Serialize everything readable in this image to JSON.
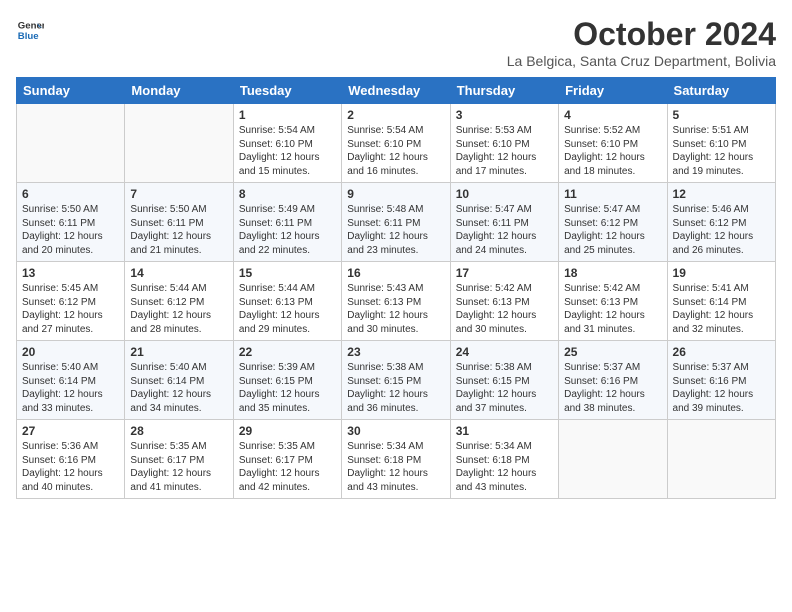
{
  "header": {
    "logo_line1": "General",
    "logo_line2": "Blue",
    "month": "October 2024",
    "location": "La Belgica, Santa Cruz Department, Bolivia"
  },
  "days_of_week": [
    "Sunday",
    "Monday",
    "Tuesday",
    "Wednesday",
    "Thursday",
    "Friday",
    "Saturday"
  ],
  "weeks": [
    [
      {
        "day": "",
        "info": ""
      },
      {
        "day": "",
        "info": ""
      },
      {
        "day": "1",
        "info": "Sunrise: 5:54 AM\nSunset: 6:10 PM\nDaylight: 12 hours and 15 minutes."
      },
      {
        "day": "2",
        "info": "Sunrise: 5:54 AM\nSunset: 6:10 PM\nDaylight: 12 hours and 16 minutes."
      },
      {
        "day": "3",
        "info": "Sunrise: 5:53 AM\nSunset: 6:10 PM\nDaylight: 12 hours and 17 minutes."
      },
      {
        "day": "4",
        "info": "Sunrise: 5:52 AM\nSunset: 6:10 PM\nDaylight: 12 hours and 18 minutes."
      },
      {
        "day": "5",
        "info": "Sunrise: 5:51 AM\nSunset: 6:10 PM\nDaylight: 12 hours and 19 minutes."
      }
    ],
    [
      {
        "day": "6",
        "info": "Sunrise: 5:50 AM\nSunset: 6:11 PM\nDaylight: 12 hours and 20 minutes."
      },
      {
        "day": "7",
        "info": "Sunrise: 5:50 AM\nSunset: 6:11 PM\nDaylight: 12 hours and 21 minutes."
      },
      {
        "day": "8",
        "info": "Sunrise: 5:49 AM\nSunset: 6:11 PM\nDaylight: 12 hours and 22 minutes."
      },
      {
        "day": "9",
        "info": "Sunrise: 5:48 AM\nSunset: 6:11 PM\nDaylight: 12 hours and 23 minutes."
      },
      {
        "day": "10",
        "info": "Sunrise: 5:47 AM\nSunset: 6:11 PM\nDaylight: 12 hours and 24 minutes."
      },
      {
        "day": "11",
        "info": "Sunrise: 5:47 AM\nSunset: 6:12 PM\nDaylight: 12 hours and 25 minutes."
      },
      {
        "day": "12",
        "info": "Sunrise: 5:46 AM\nSunset: 6:12 PM\nDaylight: 12 hours and 26 minutes."
      }
    ],
    [
      {
        "day": "13",
        "info": "Sunrise: 5:45 AM\nSunset: 6:12 PM\nDaylight: 12 hours and 27 minutes."
      },
      {
        "day": "14",
        "info": "Sunrise: 5:44 AM\nSunset: 6:12 PM\nDaylight: 12 hours and 28 minutes."
      },
      {
        "day": "15",
        "info": "Sunrise: 5:44 AM\nSunset: 6:13 PM\nDaylight: 12 hours and 29 minutes."
      },
      {
        "day": "16",
        "info": "Sunrise: 5:43 AM\nSunset: 6:13 PM\nDaylight: 12 hours and 30 minutes."
      },
      {
        "day": "17",
        "info": "Sunrise: 5:42 AM\nSunset: 6:13 PM\nDaylight: 12 hours and 30 minutes."
      },
      {
        "day": "18",
        "info": "Sunrise: 5:42 AM\nSunset: 6:13 PM\nDaylight: 12 hours and 31 minutes."
      },
      {
        "day": "19",
        "info": "Sunrise: 5:41 AM\nSunset: 6:14 PM\nDaylight: 12 hours and 32 minutes."
      }
    ],
    [
      {
        "day": "20",
        "info": "Sunrise: 5:40 AM\nSunset: 6:14 PM\nDaylight: 12 hours and 33 minutes."
      },
      {
        "day": "21",
        "info": "Sunrise: 5:40 AM\nSunset: 6:14 PM\nDaylight: 12 hours and 34 minutes."
      },
      {
        "day": "22",
        "info": "Sunrise: 5:39 AM\nSunset: 6:15 PM\nDaylight: 12 hours and 35 minutes."
      },
      {
        "day": "23",
        "info": "Sunrise: 5:38 AM\nSunset: 6:15 PM\nDaylight: 12 hours and 36 minutes."
      },
      {
        "day": "24",
        "info": "Sunrise: 5:38 AM\nSunset: 6:15 PM\nDaylight: 12 hours and 37 minutes."
      },
      {
        "day": "25",
        "info": "Sunrise: 5:37 AM\nSunset: 6:16 PM\nDaylight: 12 hours and 38 minutes."
      },
      {
        "day": "26",
        "info": "Sunrise: 5:37 AM\nSunset: 6:16 PM\nDaylight: 12 hours and 39 minutes."
      }
    ],
    [
      {
        "day": "27",
        "info": "Sunrise: 5:36 AM\nSunset: 6:16 PM\nDaylight: 12 hours and 40 minutes."
      },
      {
        "day": "28",
        "info": "Sunrise: 5:35 AM\nSunset: 6:17 PM\nDaylight: 12 hours and 41 minutes."
      },
      {
        "day": "29",
        "info": "Sunrise: 5:35 AM\nSunset: 6:17 PM\nDaylight: 12 hours and 42 minutes."
      },
      {
        "day": "30",
        "info": "Sunrise: 5:34 AM\nSunset: 6:18 PM\nDaylight: 12 hours and 43 minutes."
      },
      {
        "day": "31",
        "info": "Sunrise: 5:34 AM\nSunset: 6:18 PM\nDaylight: 12 hours and 43 minutes."
      },
      {
        "day": "",
        "info": ""
      },
      {
        "day": "",
        "info": ""
      }
    ]
  ]
}
